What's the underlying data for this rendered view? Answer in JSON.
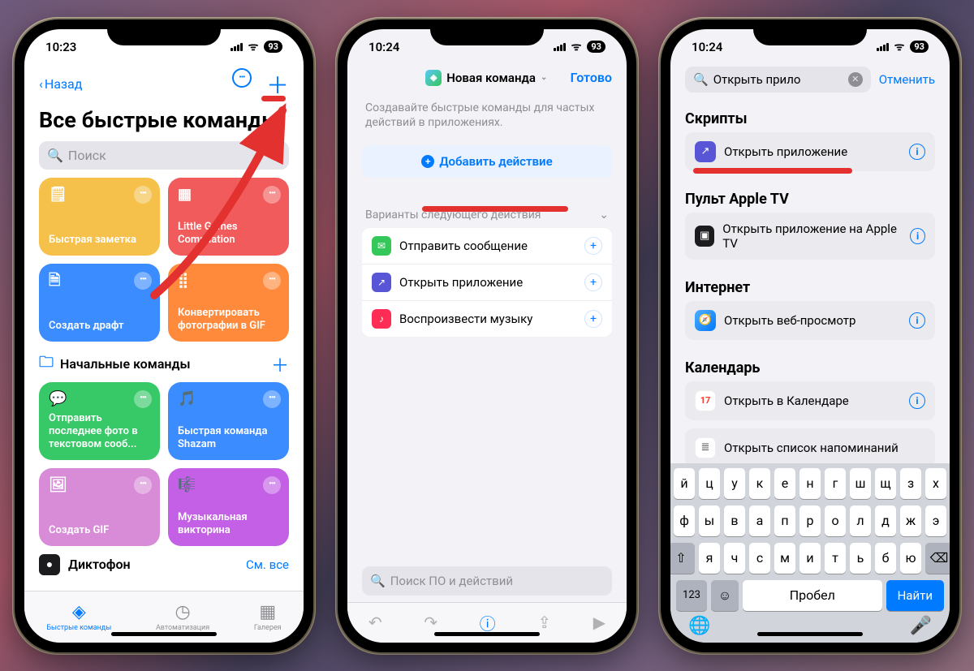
{
  "status": {
    "time1": "10:23",
    "time2": "10:24",
    "time3": "10:24",
    "battery": "93"
  },
  "p1": {
    "back": "Назад",
    "title": "Все быстрые команды",
    "search": "Поиск",
    "tiles": [
      {
        "label": "Быстрая заметка",
        "color": "#f5c14b"
      },
      {
        "label": "Little Games Compilation",
        "color": "#f25b5b"
      },
      {
        "label": "Создать драфт",
        "color": "#3a8cff"
      },
      {
        "label": "Конвертировать фотографии в GIF",
        "color": "#ff8a3c"
      }
    ],
    "folder": "Начальные команды",
    "tiles2": [
      {
        "label": "Отправить последнее фото в текстовом сооб...",
        "color": "#37c867"
      },
      {
        "label": "Быстрая команда Shazam",
        "color": "#3a8cff"
      },
      {
        "label": "Создать GIF",
        "color": "#d88cd8"
      },
      {
        "label": "Музыкальная викторина",
        "color": "#c360e6"
      }
    ],
    "dictaphone": "Диктофон",
    "see_all": "См. все",
    "tabs": {
      "shortcuts": "Быстрые команды",
      "automation": "Автоматизация",
      "gallery": "Галерея"
    }
  },
  "p2": {
    "title": "Новая команда",
    "done": "Готово",
    "hint": "Создавайте быстрые команды для частых действий в приложениях.",
    "add": "Добавить действие",
    "sugg_head": "Варианты следующего действия",
    "suggestions": [
      {
        "label": "Отправить сообщение",
        "color": "#34c759"
      },
      {
        "label": "Открыть приложение",
        "color": "#5856d6"
      },
      {
        "label": "Воспроизвести музыку",
        "color": "#ff2d55"
      }
    ],
    "search": "Поиск ПО и действий"
  },
  "p3": {
    "query": "Открыть прило",
    "cancel": "Отменить",
    "sections": [
      {
        "head": "Скрипты",
        "items": [
          {
            "label": "Открыть приложение",
            "color": "#5856d6",
            "glyph": "↗"
          }
        ]
      },
      {
        "head": "Пульт Apple TV",
        "items": [
          {
            "label": "Открыть приложение на Apple TV",
            "color": "#1c1c1e",
            "glyph": "▣"
          }
        ]
      },
      {
        "head": "Интернет",
        "items": [
          {
            "label": "Открыть веб-просмотр",
            "color": "#1e90ff",
            "glyph": "🧭"
          }
        ]
      },
      {
        "head": "Календарь",
        "items": [
          {
            "label": "Открыть в Календаре",
            "color": "#ffffff",
            "glyph": "17",
            "text_color": "#ff3b30"
          },
          {
            "label": "Открыть список напоминаний",
            "color": "#ffffff",
            "glyph": "≣",
            "text_color": "#ff9500"
          }
        ]
      }
    ],
    "keyboard": {
      "r1": [
        "й",
        "ц",
        "у",
        "к",
        "е",
        "н",
        "г",
        "ш",
        "щ",
        "з",
        "х"
      ],
      "r2": [
        "ф",
        "ы",
        "в",
        "а",
        "п",
        "р",
        "о",
        "л",
        "д",
        "ж",
        "э"
      ],
      "r3": [
        "я",
        "ч",
        "с",
        "м",
        "и",
        "т",
        "ь",
        "б",
        "ю"
      ],
      "num": "123",
      "space": "Пробел",
      "find": "Найти"
    }
  }
}
